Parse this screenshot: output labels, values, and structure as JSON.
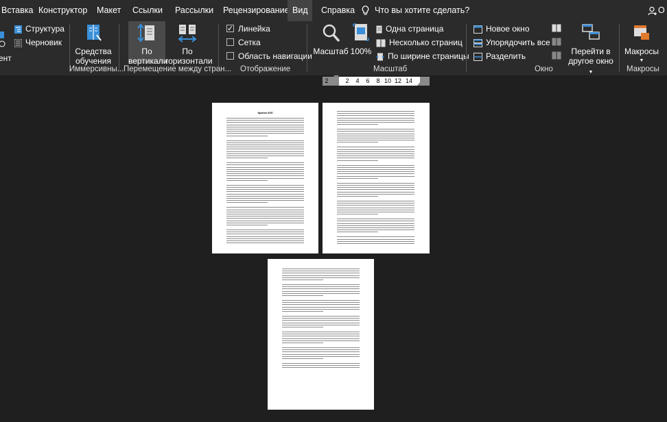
{
  "tabs": [
    {
      "label": "Вставка",
      "active": false
    },
    {
      "label": "Конструктор",
      "active": false
    },
    {
      "label": "Макет",
      "active": false
    },
    {
      "label": "Ссылки",
      "active": false
    },
    {
      "label": "Рассылки",
      "active": false
    },
    {
      "label": "Рецензирование",
      "active": false
    },
    {
      "label": "Вид",
      "active": true
    },
    {
      "label": "Справка",
      "active": false
    }
  ],
  "tellme": "Что вы хотите сделать?",
  "share_label": "О",
  "ribbon": {
    "views": {
      "left_fragment": "ент",
      "structure": "Структура",
      "draft": "Черновик"
    },
    "immersive": {
      "learning_tools_line1": "Средства",
      "learning_tools_line2": "обучения",
      "group": "Иммерсивны..."
    },
    "page_movement": {
      "vertical_line1": "По",
      "vertical_line2": "вертикали",
      "horizontal_line1": "По",
      "horizontal_line2": "горизонтали",
      "group": "Перемещение между стран..."
    },
    "show": {
      "ruler": "Линейка",
      "ruler_checked": true,
      "grid": "Сетка",
      "grid_checked": false,
      "nav_pane": "Область навигации",
      "nav_pane_checked": false,
      "group": "Отображение"
    },
    "zoom": {
      "zoom": "Масштаб",
      "percent": "100%",
      "one_page": "Одна страница",
      "multiple_pages": "Несколько страниц",
      "page_width": "По ширине страницы",
      "group": "Масштаб"
    },
    "window": {
      "new_window": "Новое окно",
      "arrange_all": "Упорядочить все",
      "split": "Разделить",
      "switch_line1": "Перейти в",
      "switch_line2": "другое окно",
      "group": "Окно"
    },
    "macros": {
      "macros": "Макросы",
      "group": "Макросы"
    }
  },
  "ruler": {
    "numbers": [
      "2",
      "2",
      "4",
      "6",
      "8",
      "10",
      "12",
      "14"
    ]
  },
  "pages": {
    "page1_title": "Кратко 00Л"
  },
  "colors": {
    "background": "#1f1f1f",
    "ribbon": "#2b2b2b",
    "active_tab": "#444444",
    "icon_blue": "#3a8fd8",
    "icon_orange": "#e07a2e"
  }
}
